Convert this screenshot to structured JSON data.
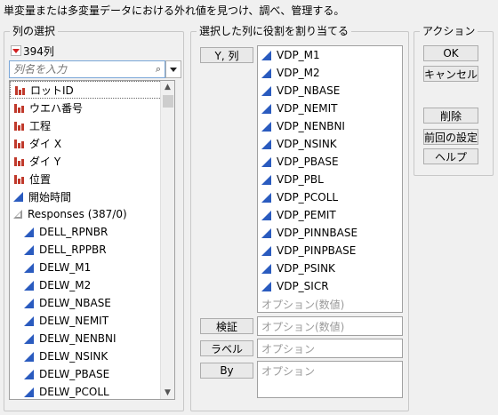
{
  "description": "単変量または多変量データにおける外れ値を見つけ、調べ、管理する。",
  "column_select": {
    "title": "列の選択",
    "count": "394列",
    "search_placeholder": "列名を入力",
    "items": [
      {
        "label": "ロットID",
        "type": "nominal"
      },
      {
        "label": "ウエハ番号",
        "type": "nominal"
      },
      {
        "label": "工程",
        "type": "nominal"
      },
      {
        "label": "ダイ X",
        "type": "nominal"
      },
      {
        "label": "ダイ Y",
        "type": "nominal"
      },
      {
        "label": "位置",
        "type": "nominal"
      },
      {
        "label": "開始時間",
        "type": "continuous"
      },
      {
        "label": "Responses (387/0)",
        "type": "group"
      },
      {
        "label": "DELL_RPNBR",
        "type": "continuous"
      },
      {
        "label": "DELL_RPPBR",
        "type": "continuous"
      },
      {
        "label": "DELW_M1",
        "type": "continuous"
      },
      {
        "label": "DELW_M2",
        "type": "continuous"
      },
      {
        "label": "DELW_NBASE",
        "type": "continuous"
      },
      {
        "label": "DELW_NEMIT",
        "type": "continuous"
      },
      {
        "label": "DELW_NENBNI",
        "type": "continuous"
      },
      {
        "label": "DELW_NSINK",
        "type": "continuous"
      },
      {
        "label": "DELW_PBASE",
        "type": "continuous"
      },
      {
        "label": "DELW_PCOLL",
        "type": "continuous"
      }
    ]
  },
  "roles": {
    "title": "選択した列に役割を割り当てる",
    "y": {
      "button": "Y, 列",
      "items": [
        "VDP_M1",
        "VDP_M2",
        "VDP_NBASE",
        "VDP_NEMIT",
        "VDP_NENBNI",
        "VDP_NSINK",
        "VDP_PBASE",
        "VDP_PBL",
        "VDP_PCOLL",
        "VDP_PEMIT",
        "VDP_PINNBASE",
        "VDP_PINPBASE",
        "VDP_PSINK",
        "VDP_SICR"
      ],
      "placeholder": "オプション(数値)"
    },
    "validation": {
      "button": "検証",
      "placeholder": "オプション(数値)"
    },
    "label": {
      "button": "ラベル",
      "placeholder": "オプション"
    },
    "by": {
      "button": "By",
      "placeholder": "オプション"
    }
  },
  "actions": {
    "title": "アクション",
    "ok": "OK",
    "cancel": "キャンセル",
    "remove": "削除",
    "recall": "前回の設定",
    "help": "ヘルプ"
  },
  "colors": {
    "nominal_icon": "#c0392b",
    "continuous_icon": "#2a5bbf"
  }
}
